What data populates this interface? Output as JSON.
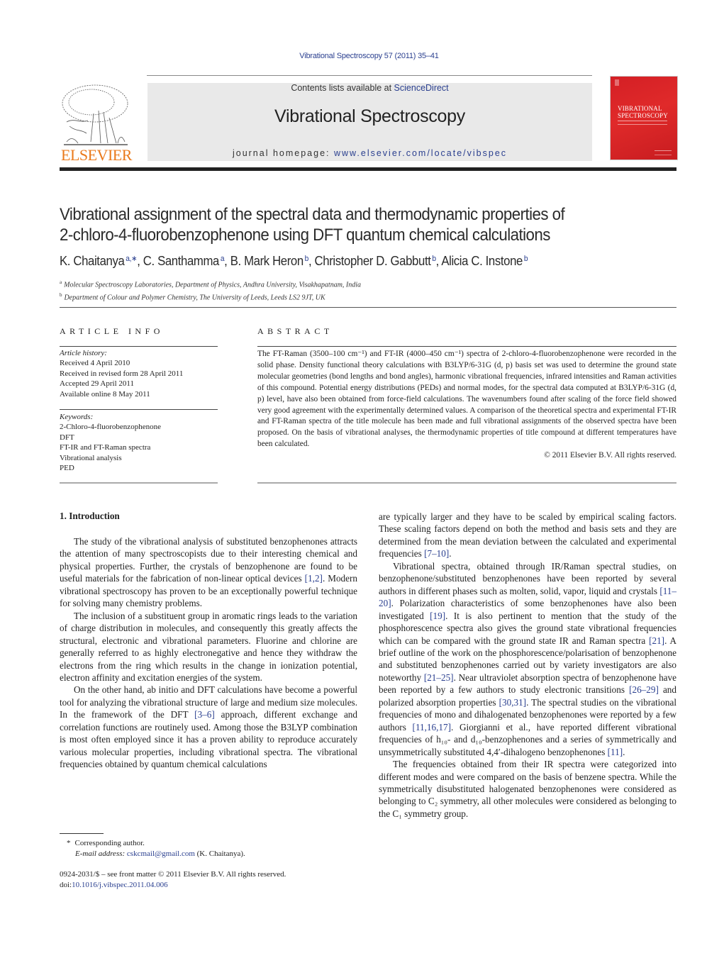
{
  "header": {
    "journal_reference": "Vibrational Spectroscopy 57 (2011) 35–41",
    "publisher_logo_text": "ELSEVIER",
    "contents_prefix": "Contents lists available at ",
    "contents_link": "ScienceDirect",
    "journal_title": "Vibrational Spectroscopy",
    "homepage_prefix": "journal homepage: ",
    "homepage_link": "www.elsevier.com/locate/vibspec",
    "cover_title_line1": "VIBRATIONAL",
    "cover_title_line2": "SPECTROSCOPY"
  },
  "article": {
    "title_line1": "Vibrational assignment of the spectral data and thermodynamic properties of",
    "title_line2": "2-chloro-4-fluorobenzophenone using DFT quantum chemical calculations",
    "authors": [
      {
        "name": "K. Chaitanya",
        "aff": "a,∗"
      },
      {
        "name": "C. Santhamma",
        "aff": "a"
      },
      {
        "name": "B. Mark Heron",
        "aff": "b"
      },
      {
        "name": "Christopher D. Gabbutt",
        "aff": "b"
      },
      {
        "name": "Alicia C. Instone",
        "aff": "b"
      }
    ],
    "affiliations": [
      {
        "key": "a",
        "text": "Molecular Spectroscopy Laboratories, Department of Physics, Andhra University, Visakhapatnam, India"
      },
      {
        "key": "b",
        "text": "Department of Colour and Polymer Chemistry, The University of Leeds, Leeds LS2 9JT, UK"
      }
    ]
  },
  "article_info": {
    "heading": "ARTICLE INFO",
    "history_label": "Article history:",
    "history": [
      "Received 4 April 2010",
      "Received in revised form 28 April 2011",
      "Accepted 29 April 2011",
      "Available online 8 May 2011"
    ],
    "keywords_label": "Keywords:",
    "keywords": [
      "2-Chloro-4-fluorobenzophenone",
      "DFT",
      "FT-IR and FT-Raman spectra",
      "Vibrational analysis",
      "PED"
    ]
  },
  "abstract": {
    "heading": "ABSTRACT",
    "text": "The FT-Raman (3500–100 cm⁻¹) and FT-IR (4000–450 cm⁻¹) spectra of 2-chloro-4-fluorobenzophenone were recorded in the solid phase. Density functional theory calculations with B3LYP/6-31G (d, p) basis set was used to determine the ground state molecular geometries (bond lengths and bond angles), harmonic vibrational frequencies, infrared intensities and Raman activities of this compound. Potential energy distributions (PEDs) and normal modes, for the spectral data computed at B3LYP/6-31G (d, p) level, have also been obtained from force-field calculations. The wavenumbers found after scaling of the force field showed very good agreement with the experimentally determined values. A comparison of the theoretical spectra and experimental FT-IR and FT-Raman spectra of the title molecule has been made and full vibrational assignments of the observed spectra have been proposed. On the basis of vibrational analyses, the thermodynamic properties of title compound at different temperatures have been calculated.",
    "copyright": "© 2011 Elsevier B.V. All rights reserved."
  },
  "body": {
    "section_heading": "1.  Introduction",
    "left_paragraphs": [
      [
        "The study of the vibrational analysis of substituted benzophenones attracts the attention of many spectroscopists due to their interesting chemical and physical properties. Further, the crystals of benzophenone are found to be useful materials for the fabrication of non-linear optical devices ",
        "[1,2]",
        ". Modern vibrational spectroscopy has proven to be an exceptionally powerful technique for solving many chemistry problems."
      ],
      [
        "The inclusion of a substituent group in aromatic rings leads to the variation of charge distribution in molecules, and consequently this greatly affects the structural, electronic and vibrational parameters. Fluorine and chlorine are generally referred to as highly electronegative and hence they withdraw the electrons from the ring which results in the change in ionization potential, electron affinity and excitation energies of the system."
      ],
      [
        "On the other hand, ab initio and DFT calculations have become a powerful tool for analyzing the vibrational structure of large and medium size molecules. In the framework of the DFT ",
        "[3–6]",
        " approach, different exchange and correlation functions are routinely used. Among those the B3LYP combination is most often employed since it has a proven ability to reproduce accurately various molecular properties, including vibrational spectra. The vibrational frequencies obtained by quantum chemical calculations"
      ]
    ],
    "right_paragraphs": [
      [
        "are typically larger and they have to be scaled by empirical scaling factors. These scaling factors depend on both the method and basis sets and they are determined from the mean deviation between the calculated and experimental frequencies ",
        "[7–10]",
        "."
      ],
      [
        "Vibrational spectra, obtained through IR/Raman spectral studies, on benzophenone/substituted benzophenones have been reported by several authors in different phases such as molten, solid, vapor, liquid and crystals ",
        "[11–20]",
        ". Polarization characteristics of some benzophenones have also been investigated ",
        "[19]",
        ". It is also pertinent to mention that the study of the phosphorescence spectra also gives the ground state vibrational frequencies which can be compared with the ground state IR and Raman spectra ",
        "[21]",
        ". A brief outline of the work on the phosphorescence/polarisation of benzophenone and substituted benzophenones carried out by variety investigators are also noteworthy ",
        "[21–25]",
        ". Near ultraviolet absorption spectra of benzophenone have been reported by a few authors to study electronic transitions ",
        "[26–29]",
        " and polarized absorption properties ",
        "[30,31]",
        ". The spectral studies on the vibrational frequencies of mono and dihalogenated benzophenones were reported by a few authors ",
        "[11,16,17]",
        ". Giorgianni et al., have reported different vibrational frequencies of h₁₀- and d₁₀-benzophenones and a series of symmetrically and unsymmetrically substituted 4,4′-dihalogeno benzophenones ",
        "[11]",
        "."
      ],
      [
        "The frequencies obtained from their IR spectra were categorized into different modes and were compared on the basis of benzene spectra. While the symmetrically disubstituted halogenated benzophenones were considered as belonging to C₂ symmetry, all other molecules were considered as belonging to the C₁ symmetry group."
      ]
    ]
  },
  "footnote": {
    "marker": "*",
    "corresponding": "Corresponding author.",
    "email_label": "E-mail address: ",
    "email": "cskcmail@gmail.com",
    "email_owner": " (K. Chaitanya)."
  },
  "front_matter": {
    "issn_line": "0924-2031/$ – see front matter © 2011 Elsevier B.V. All rights reserved.",
    "doi_prefix": "doi:",
    "doi": "10.1016/j.vibspec.2011.04.006"
  }
}
